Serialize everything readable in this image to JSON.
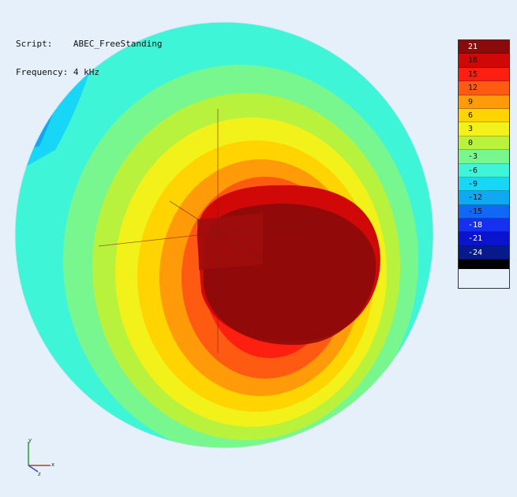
{
  "info": {
    "script_label": "Script:",
    "script_value": "ABEC_FreeStanding",
    "frequency_label": "Frequency:",
    "frequency_value": "4 kHz"
  },
  "legend": {
    "levels": [
      {
        "label": "21",
        "color": "#8b0a0a"
      },
      {
        "label": "18",
        "color": "#d10808"
      },
      {
        "label": "15",
        "color": "#ff1f10"
      },
      {
        "label": "12",
        "color": "#ff5a12"
      },
      {
        "label": "9",
        "color": "#ff9a08"
      },
      {
        "label": "6",
        "color": "#ffd400"
      },
      {
        "label": "3",
        "color": "#f2f21a"
      },
      {
        "label": "0",
        "color": "#b9f23c"
      },
      {
        "label": "-3",
        "color": "#78f78e"
      },
      {
        "label": "-6",
        "color": "#3ff5d8"
      },
      {
        "label": "-9",
        "color": "#18d6f5"
      },
      {
        "label": "-12",
        "color": "#0fa8f2"
      },
      {
        "label": "-15",
        "color": "#1068f5"
      },
      {
        "label": "-18",
        "color": "#1530f0"
      },
      {
        "label": "-21",
        "color": "#0a14cc"
      },
      {
        "label": "-24",
        "color": "#071a8c"
      }
    ],
    "bottom_color": "#000000"
  },
  "axes": {
    "x_label": "x",
    "y_label": "y",
    "z_label": "z"
  }
}
